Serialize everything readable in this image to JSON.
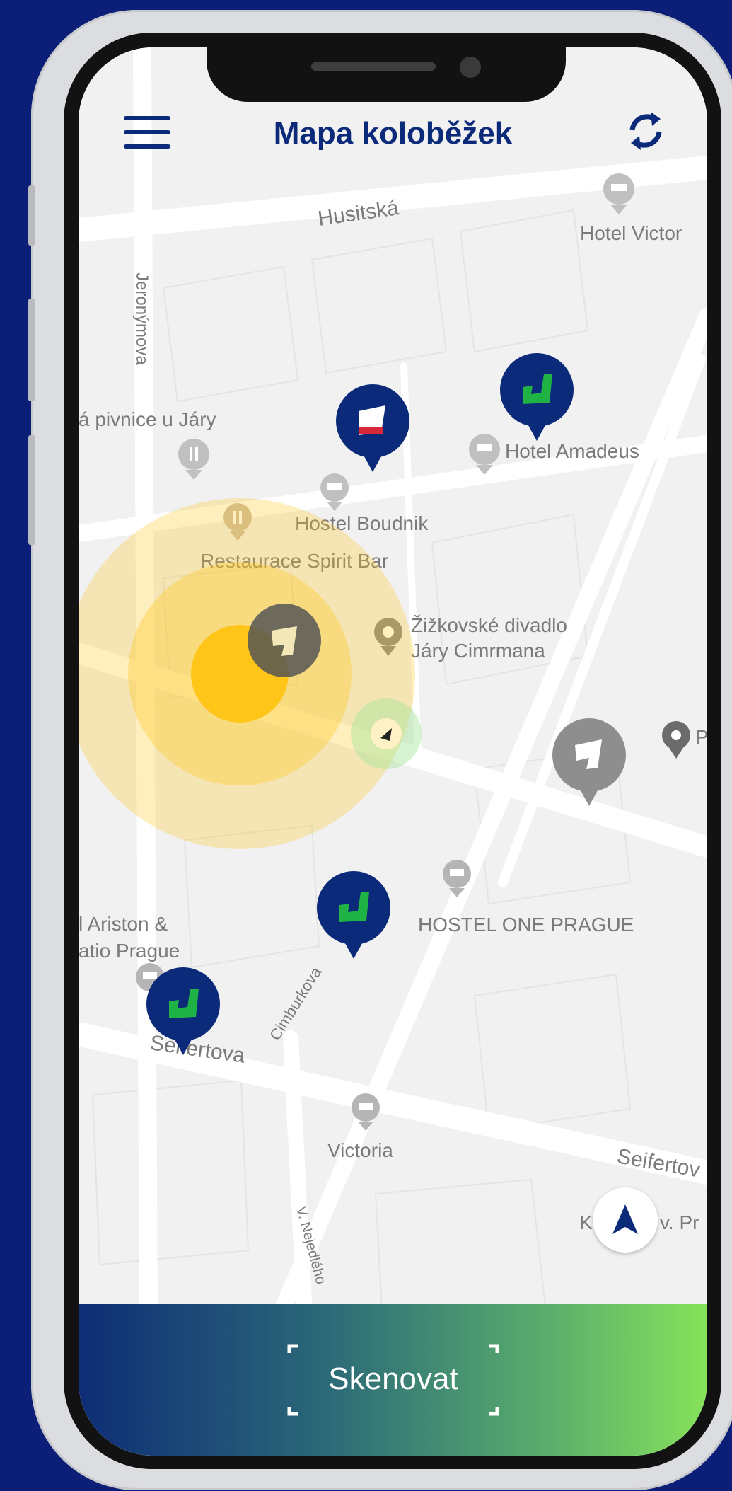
{
  "app": {
    "title": "Mapa koloběžek",
    "scan_label": "Skenovat"
  },
  "map": {
    "streets": [
      "Husitská",
      "Jeronýmova",
      "Seifertova",
      "Cimburkova",
      "Seifertov",
      "V. Nejedlého"
    ],
    "places": [
      {
        "name": "Hotel Victor",
        "icon": "hotel-icon"
      },
      {
        "name": "á pivnice u Járy",
        "icon": "restaurant-icon"
      },
      {
        "name": "Hotel Amadeus",
        "icon": "hotel-icon"
      },
      {
        "name": "Hostel Boudnik",
        "icon": "hotel-icon"
      },
      {
        "name": "Restaurace Spirit Bar",
        "icon": "restaurant-icon"
      },
      {
        "name_line1": "Žižkovské divadlo",
        "name_line2": "Járy Cimrmana",
        "icon": "theater-icon"
      },
      {
        "name": "P",
        "icon": "place-icon"
      },
      {
        "name": "HOSTEL ONE PRAGUE",
        "icon": "hotel-icon"
      },
      {
        "name_line1": "l Ariston &",
        "name_line2": "atio Prague",
        "icon": "hotel-icon"
      },
      {
        "name": "Victoria",
        "icon": "hotel-icon"
      },
      {
        "name": "K",
        "name2": "v. Pr",
        "icon": "place-icon"
      }
    ],
    "scooters": [
      {
        "status": "available",
        "battery_color": "#1fb345"
      },
      {
        "status": "available",
        "battery_color": "#d9283a"
      },
      {
        "status": "available",
        "battery_color": "#1fb345"
      },
      {
        "status": "available",
        "battery_color": "#1fb345"
      },
      {
        "status": "unavailable",
        "battery_color": "#ffffff"
      },
      {
        "status": "unavailable",
        "battery_color": "#ffffff"
      }
    ]
  },
  "colors": {
    "brand_navy": "#0b2a7a",
    "accent_green": "#86e25a",
    "user_location": "#ffc519"
  },
  "icons": [
    "menu-icon",
    "refresh-icon",
    "scan-frame-icon",
    "navigation-arrow-icon"
  ]
}
